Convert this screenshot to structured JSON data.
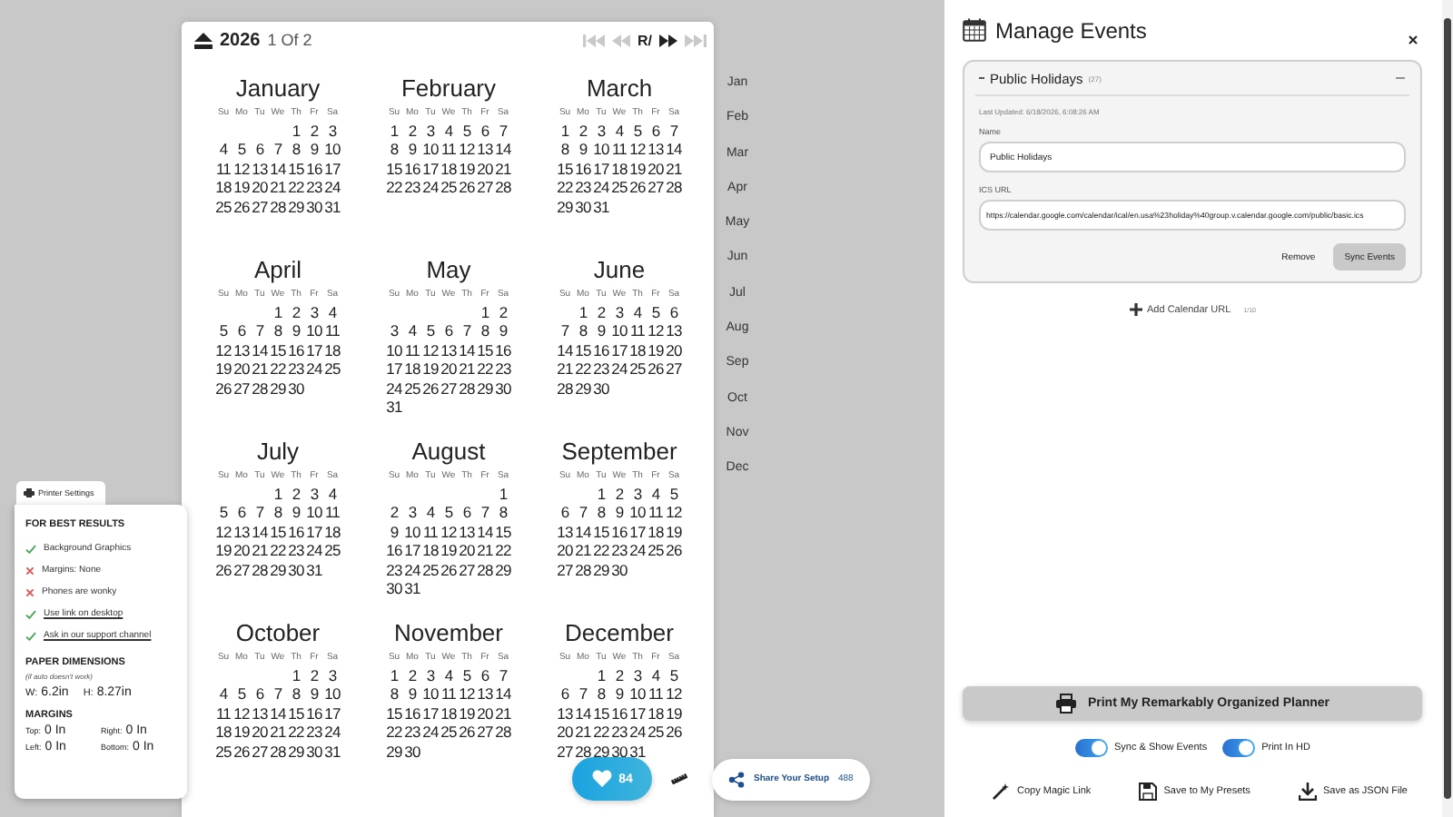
{
  "calendar": {
    "year": "2026",
    "page_indicator": "1 Of 2",
    "nav": [
      {
        "kind": "first",
        "disabled": true
      },
      {
        "kind": "prev",
        "disabled": true
      },
      {
        "kind": "label",
        "label": "R/",
        "disabled": false
      },
      {
        "kind": "next",
        "disabled": false
      },
      {
        "kind": "last",
        "disabled": true
      }
    ],
    "months": [
      {
        "name": "January",
        "weekdays": [
          "Su",
          "Mo",
          "Tu",
          "We",
          "Th",
          "Fr",
          "Sa"
        ],
        "weeks": [
          [
            "1",
            "2",
            "3"
          ],
          [
            "4",
            "5",
            "6",
            "7",
            "8",
            "9",
            "10"
          ],
          [
            "11",
            "12",
            "13",
            "14",
            "15",
            "16",
            "17"
          ],
          [
            "18",
            "19",
            "20",
            "21",
            "22",
            "23",
            "24"
          ],
          [
            "25",
            "26",
            "27",
            "28",
            "29",
            "30",
            "31"
          ]
        ]
      },
      {
        "name": "February",
        "weekdays": [
          "Su",
          "Mo",
          "Tu",
          "We",
          "Th",
          "Fr",
          "Sa"
        ],
        "weeks": [
          [
            "1",
            "2",
            "3",
            "4",
            "5",
            "6",
            "7"
          ],
          [
            "8",
            "9",
            "10",
            "11",
            "12",
            "13",
            "14"
          ],
          [
            "15",
            "16",
            "17",
            "18",
            "19",
            "20",
            "21"
          ],
          [
            "22",
            "23",
            "24",
            "25",
            "26",
            "27",
            "28"
          ]
        ]
      },
      {
        "name": "March",
        "weekdays": [
          "Su",
          "Mo",
          "Tu",
          "We",
          "Th",
          "Fr",
          "Sa"
        ],
        "weeks": [
          [
            "1",
            "2",
            "3",
            "4",
            "5",
            "6",
            "7"
          ],
          [
            "8",
            "9",
            "10",
            "11",
            "12",
            "13",
            "14"
          ],
          [
            "15",
            "16",
            "17",
            "18",
            "19",
            "20",
            "21"
          ],
          [
            "22",
            "23",
            "24",
            "25",
            "26",
            "27",
            "28"
          ],
          [
            "29",
            "30",
            "31"
          ]
        ]
      },
      {
        "name": "April",
        "weekdays": [
          "Su",
          "Mo",
          "Tu",
          "We",
          "Th",
          "Fr",
          "Sa"
        ],
        "weeks": [
          [
            "1",
            "2",
            "3",
            "4"
          ],
          [
            "5",
            "6",
            "7",
            "8",
            "9",
            "10",
            "11"
          ],
          [
            "12",
            "13",
            "14",
            "15",
            "16",
            "17",
            "18"
          ],
          [
            "19",
            "20",
            "21",
            "22",
            "23",
            "24",
            "25"
          ],
          [
            "26",
            "27",
            "28",
            "29",
            "30"
          ]
        ]
      },
      {
        "name": "May",
        "weekdays": [
          "Su",
          "Mo",
          "Tu",
          "We",
          "Th",
          "Fr",
          "Sa"
        ],
        "weeks": [
          [
            "1",
            "2"
          ],
          [
            "3",
            "4",
            "5",
            "6",
            "7",
            "8",
            "9"
          ],
          [
            "10",
            "11",
            "12",
            "13",
            "14",
            "15",
            "16"
          ],
          [
            "17",
            "18",
            "19",
            "20",
            "21",
            "22",
            "23"
          ],
          [
            "24",
            "25",
            "26",
            "27",
            "28",
            "29",
            "30"
          ],
          [
            "31"
          ]
        ]
      },
      {
        "name": "June",
        "weekdays": [
          "Su",
          "Mo",
          "Tu",
          "We",
          "Th",
          "Fr",
          "Sa"
        ],
        "weeks": [
          [
            "1",
            "2",
            "3",
            "4",
            "5",
            "6"
          ],
          [
            "7",
            "8",
            "9",
            "10",
            "11",
            "12",
            "13"
          ],
          [
            "14",
            "15",
            "16",
            "17",
            "18",
            "19",
            "20"
          ],
          [
            "21",
            "22",
            "23",
            "24",
            "25",
            "26",
            "27"
          ],
          [
            "28",
            "29",
            "30"
          ]
        ]
      },
      {
        "name": "July",
        "weekdays": [
          "Su",
          "Mo",
          "Tu",
          "We",
          "Th",
          "Fr",
          "Sa"
        ],
        "weeks": [
          [
            "1",
            "2",
            "3",
            "4"
          ],
          [
            "5",
            "6",
            "7",
            "8",
            "9",
            "10",
            "11"
          ],
          [
            "12",
            "13",
            "14",
            "15",
            "16",
            "17",
            "18"
          ],
          [
            "19",
            "20",
            "21",
            "22",
            "23",
            "24",
            "25"
          ],
          [
            "26",
            "27",
            "28",
            "29",
            "30",
            "31"
          ]
        ]
      },
      {
        "name": "August",
        "weekdays": [
          "Su",
          "Mo",
          "Tu",
          "We",
          "Th",
          "Fr",
          "Sa"
        ],
        "weeks": [
          [
            "1"
          ],
          [
            "2",
            "3",
            "4",
            "5",
            "6",
            "7",
            "8"
          ],
          [
            "9",
            "10",
            "11",
            "12",
            "13",
            "14",
            "15"
          ],
          [
            "16",
            "17",
            "18",
            "19",
            "20",
            "21",
            "22"
          ],
          [
            "23",
            "24",
            "25",
            "26",
            "27",
            "28",
            "29"
          ],
          [
            "30",
            "31"
          ]
        ]
      },
      {
        "name": "September",
        "weekdays": [
          "Su",
          "Mo",
          "Tu",
          "We",
          "Th",
          "Fr",
          "Sa"
        ],
        "weeks": [
          [
            "1",
            "2",
            "3",
            "4",
            "5"
          ],
          [
            "6",
            "7",
            "8",
            "9",
            "10",
            "11",
            "12"
          ],
          [
            "13",
            "14",
            "15",
            "16",
            "17",
            "18",
            "19"
          ],
          [
            "20",
            "21",
            "22",
            "23",
            "24",
            "25",
            "26"
          ],
          [
            "27",
            "28",
            "29",
            "30"
          ]
        ]
      },
      {
        "name": "October",
        "weekdays": [
          "Su",
          "Mo",
          "Tu",
          "We",
          "Th",
          "Fr",
          "Sa"
        ],
        "weeks": [
          [
            "1",
            "2",
            "3"
          ],
          [
            "4",
            "5",
            "6",
            "7",
            "8",
            "9",
            "10"
          ],
          [
            "11",
            "12",
            "13",
            "14",
            "15",
            "16",
            "17"
          ],
          [
            "18",
            "19",
            "20",
            "21",
            "22",
            "23",
            "24"
          ],
          [
            "25",
            "26",
            "27",
            "28",
            "29",
            "30",
            "31"
          ]
        ]
      },
      {
        "name": "November",
        "weekdays": [
          "Su",
          "Mo",
          "Tu",
          "We",
          "Th",
          "Fr",
          "Sa"
        ],
        "weeks": [
          [
            "1",
            "2",
            "3",
            "4",
            "5",
            "6",
            "7"
          ],
          [
            "8",
            "9",
            "10",
            "11",
            "12",
            "13",
            "14"
          ],
          [
            "15",
            "16",
            "17",
            "18",
            "19",
            "20",
            "21"
          ],
          [
            "22",
            "23",
            "24",
            "25",
            "26",
            "27",
            "28"
          ],
          [
            "29",
            "30"
          ]
        ]
      },
      {
        "name": "December",
        "weekdays": [
          "Su",
          "Mo",
          "Tu",
          "We",
          "Th",
          "Fr",
          "Sa"
        ],
        "weeks": [
          [
            "1",
            "2",
            "3",
            "4",
            "5"
          ],
          [
            "6",
            "7",
            "8",
            "9",
            "10",
            "11",
            "12"
          ],
          [
            "13",
            "14",
            "15",
            "16",
            "17",
            "18",
            "19"
          ],
          [
            "20",
            "21",
            "22",
            "23",
            "24",
            "25",
            "26"
          ],
          [
            "27",
            "28",
            "29",
            "30",
            "31"
          ]
        ]
      }
    ]
  },
  "month_nav": [
    "Jan",
    "Feb",
    "Mar",
    "Apr",
    "May",
    "Jun",
    "Jul",
    "Aug",
    "Sep",
    "Oct",
    "Nov",
    "Dec"
  ],
  "printer_settings": {
    "tab_label": "Printer Settings",
    "heading": "FOR BEST RESULTS",
    "tips": [
      {
        "ok": true,
        "kind": "text",
        "text": "Background Graphics"
      },
      {
        "ok": false,
        "kind": "text",
        "text": "Margins: None"
      },
      {
        "ok": false,
        "kind": "text",
        "text": "Phones are wonky"
      },
      {
        "ok": true,
        "kind": "link",
        "text": "Use link on desktop"
      },
      {
        "ok": true,
        "kind": "link",
        "text": "Ask in our support channel"
      }
    ],
    "paper_heading": "PAPER DIMENSIONS",
    "paper_note": "(if auto doesn't work)",
    "paper": [
      {
        "label": "W:",
        "value": "6.2in"
      },
      {
        "label": "H:",
        "value": "8.27in"
      }
    ],
    "margins_heading": "MARGINS",
    "margins": [
      {
        "label": "Top:",
        "value": "0 In"
      },
      {
        "label": "Right:",
        "value": "0 In"
      },
      {
        "label": "Left:",
        "value": "0 In"
      },
      {
        "label": "Bottom:",
        "value": "0 In"
      }
    ]
  },
  "floating": {
    "likes": "84",
    "share_label": "Share Your Setup",
    "share_count": "488"
  },
  "events_panel": {
    "title": "Manage Events",
    "sources": [
      {
        "name": "Public Holidays",
        "count": "(27)",
        "expanded": true,
        "last_updated": "Last Updated: 6/18/2026, 6:08:26 AM",
        "name_label": "Name",
        "name_value": "Public Holidays",
        "url_label": "ICS URL",
        "url_value": "https://calendar.google.com/calendar/ical/en.usa%23holiday%40group.v.calendar.google.com/public/basic.ics",
        "remove_label": "Remove",
        "sync_label": "Sync Events"
      }
    ],
    "add_label": "Add Calendar URL",
    "add_count": "1/10",
    "print_label": "Print My Remarkably Organized Planner",
    "toggles": [
      {
        "label": "Sync & Show Events",
        "on": true
      },
      {
        "label": "Print In HD",
        "on": true
      }
    ],
    "actions": [
      {
        "kind": "link",
        "label": "Copy Magic Link"
      },
      {
        "kind": "preset",
        "label": "Save to My Presets"
      },
      {
        "kind": "json",
        "label": "Save as JSON File"
      }
    ]
  }
}
